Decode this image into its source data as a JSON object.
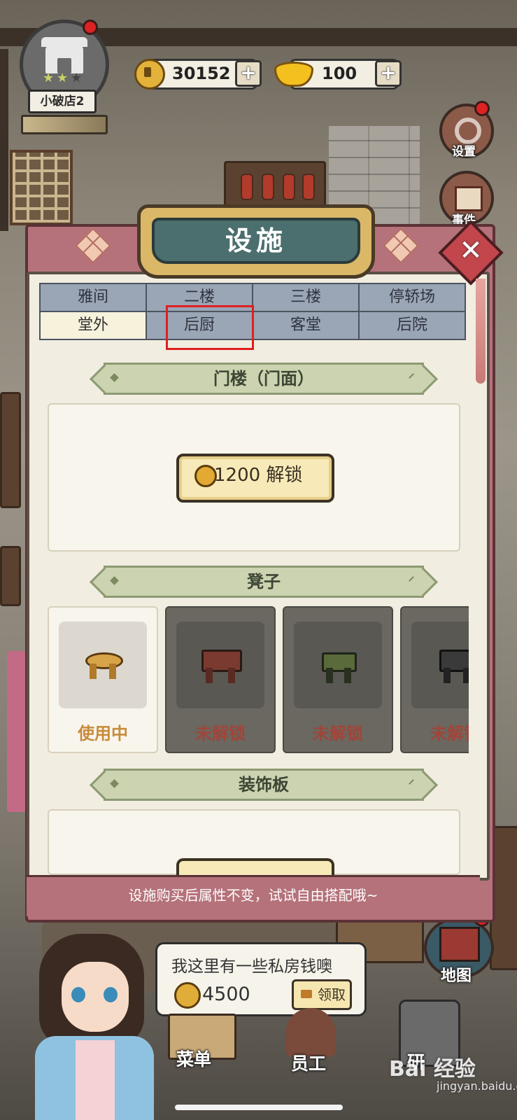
{
  "hud": {
    "shop_name": "小破店2",
    "copper_coins": "30152",
    "gold_ingots": "100",
    "plus": "+"
  },
  "side_buttons": {
    "settings": "设置",
    "events": "事件",
    "map": "地图"
  },
  "modal": {
    "title": "设施",
    "close": "✕",
    "tabs_row1": [
      "雅间",
      "二楼",
      "三楼",
      "停轿场"
    ],
    "tabs_row2": [
      "堂外",
      "后厨",
      "客堂",
      "后院"
    ],
    "active_tab": "堂外",
    "highlighted_tab": "后厨",
    "section_facade": "门楼（门面）",
    "unlock_label": "1200 解锁",
    "section_stool": "凳子",
    "stool_cards": [
      {
        "status": "使用中"
      },
      {
        "status": "未解锁"
      },
      {
        "status": "未解锁"
      },
      {
        "status": "未解锁"
      }
    ],
    "section_decor": "装饰板",
    "tip": "设施购买后属性不变，试试自由搭配哦~"
  },
  "speech": {
    "text": "我这里有一些私房钱噢",
    "amount": "4500",
    "claim_label": "领取"
  },
  "bottom_nav": {
    "menu": "菜单",
    "staff": "员工",
    "research": "研"
  },
  "watermark": {
    "main": "Bai 经验",
    "sub": "jingyan.baidu.com"
  },
  "colors": {
    "modal_frame": "#b5727a",
    "tab_inactive": "#9aa5b5",
    "tab_active": "#f6f2dc",
    "section_header": "#cbd3b0",
    "highlight": "#e02020",
    "in_use_text": "#c88b3a",
    "locked_text": "#a0453a"
  }
}
